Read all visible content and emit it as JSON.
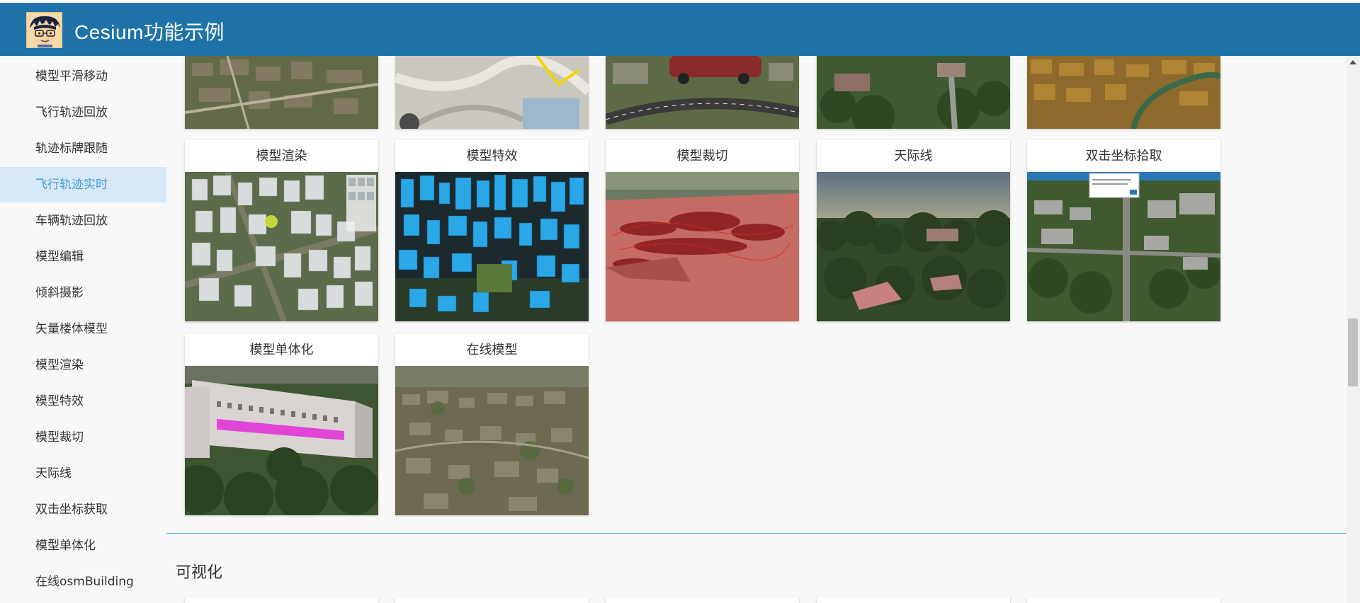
{
  "header": {
    "title": "Cesium功能示例",
    "avatar_icon": "avatar-cartoon-icon",
    "color": "#2073a8"
  },
  "sidebar": {
    "items": [
      {
        "label": "模型平滑移动",
        "active": false
      },
      {
        "label": "飞行轨迹回放",
        "active": false
      },
      {
        "label": "轨迹标牌跟随",
        "active": false
      },
      {
        "label": "飞行轨迹实时",
        "active": true
      },
      {
        "label": "车辆轨迹回放",
        "active": false
      },
      {
        "label": "模型编辑",
        "active": false
      },
      {
        "label": "倾斜摄影",
        "active": false
      },
      {
        "label": "矢量楼体模型",
        "active": false
      },
      {
        "label": "模型渲染",
        "active": false
      },
      {
        "label": "模型特效",
        "active": false
      },
      {
        "label": "模型裁切",
        "active": false
      },
      {
        "label": "天际线",
        "active": false
      },
      {
        "label": "双击坐标获取",
        "active": false
      },
      {
        "label": "模型单体化",
        "active": false
      },
      {
        "label": "在线osmBuilding",
        "active": false
      }
    ],
    "active_color": "#4a9bd6",
    "active_bg": "#d7e9f8"
  },
  "gallery": {
    "cards": [
      {
        "title": "模型渲染",
        "thumb": "city-white-buildings"
      },
      {
        "title": "模型特效",
        "thumb": "city-blue-glow"
      },
      {
        "title": "模型裁切",
        "thumb": "terrain-red-clip"
      },
      {
        "title": "天际线",
        "thumb": "forest-skyline"
      },
      {
        "title": "双击坐标拾取",
        "thumb": "campus-aerial-popup"
      },
      {
        "title": "模型单体化",
        "thumb": "building-highlight"
      },
      {
        "title": "在线模型",
        "thumb": "city-oblique"
      }
    ]
  },
  "sections": {
    "next_title": "可视化"
  }
}
